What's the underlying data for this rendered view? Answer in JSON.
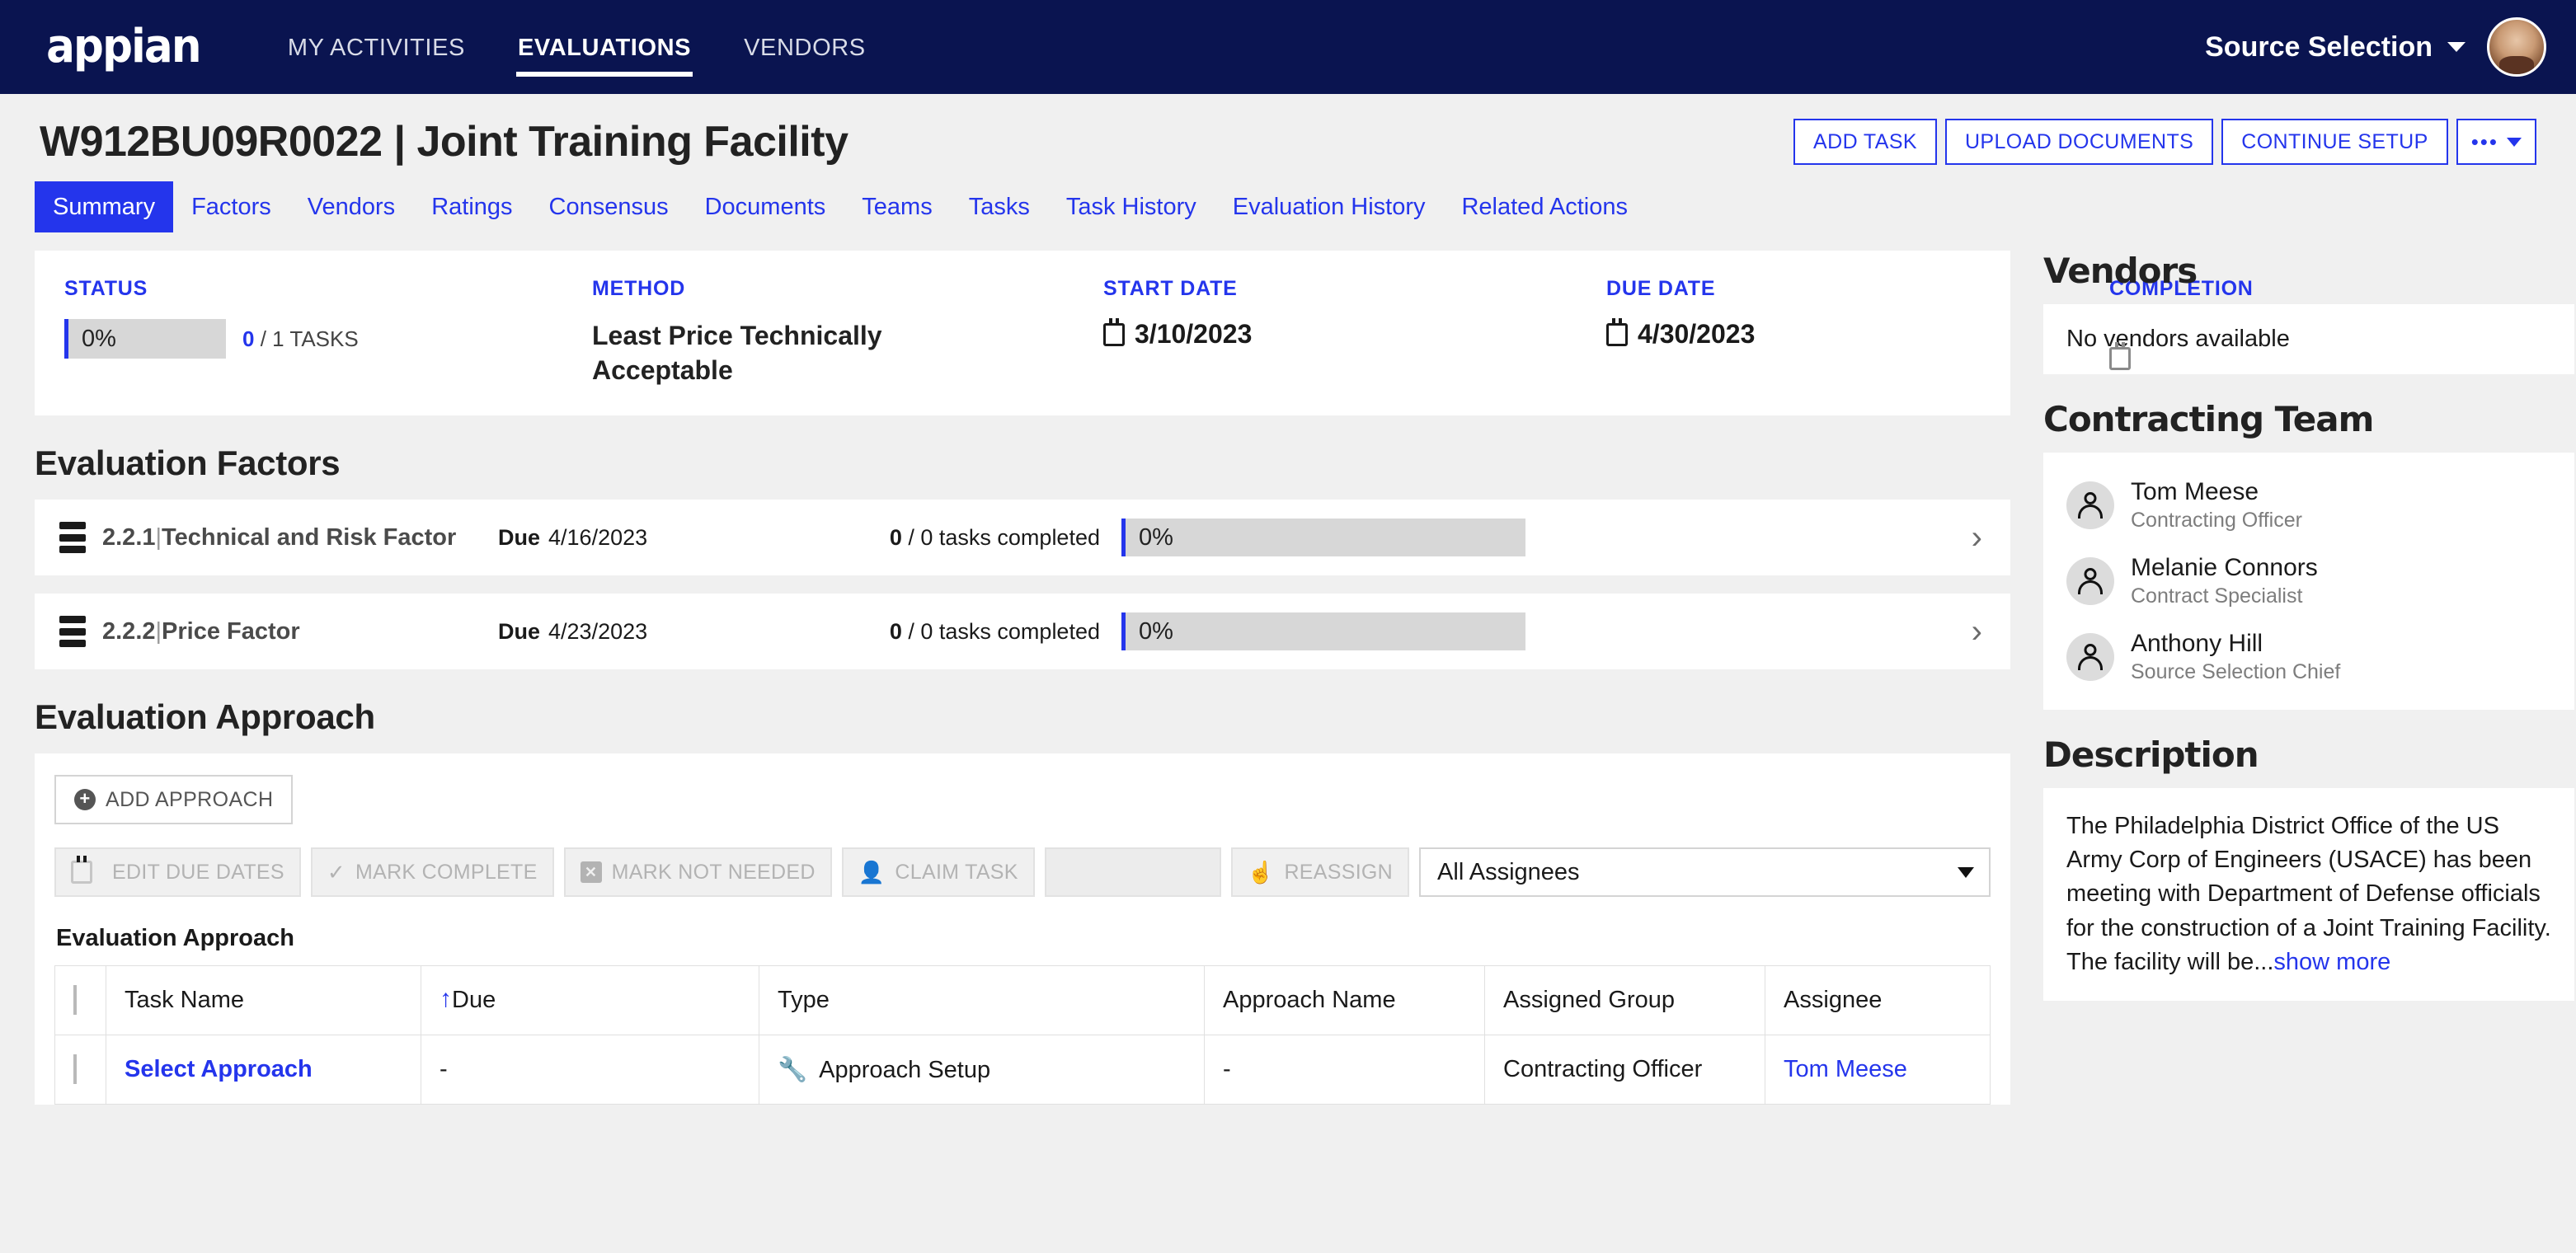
{
  "topnav": {
    "logo": "appian",
    "items": [
      {
        "label": "MY ACTIVITIES",
        "active": false
      },
      {
        "label": "EVALUATIONS",
        "active": true
      },
      {
        "label": "VENDORS",
        "active": false
      }
    ],
    "user": "Source Selection",
    "accent": "#0a1450"
  },
  "header": {
    "title": "W912BU09R0022 | Joint Training Facility",
    "actions": {
      "add_task": "ADD TASK",
      "upload_documents": "UPLOAD DOCUMENTS",
      "continue_setup": "CONTINUE SETUP",
      "more": "•••"
    }
  },
  "tabs": [
    {
      "label": "Summary",
      "active": true
    },
    {
      "label": "Factors",
      "active": false
    },
    {
      "label": "Vendors",
      "active": false
    },
    {
      "label": "Ratings",
      "active": false
    },
    {
      "label": "Consensus",
      "active": false
    },
    {
      "label": "Documents",
      "active": false
    },
    {
      "label": "Teams",
      "active": false
    },
    {
      "label": "Tasks",
      "active": false
    },
    {
      "label": "Task History",
      "active": false
    },
    {
      "label": "Evaluation History",
      "active": false
    },
    {
      "label": "Related Actions",
      "active": false
    }
  ],
  "status_card": {
    "status_label": "STATUS",
    "status_percent": "0%",
    "tasks_done": "0",
    "tasks_total_text": "/ 1 TASKS",
    "method_label": "METHOD",
    "method_value": "Least Price Technically Acceptable",
    "start_label": "START DATE",
    "start_value": "3/10/2023",
    "due_label": "DUE DATE",
    "due_value": "4/30/2023",
    "completion_label": "COMPLETION DATE",
    "completion_value": "--/--/--"
  },
  "factors": {
    "heading": "Evaluation Factors",
    "rows": [
      {
        "name": "2.2.1",
        "sep": "|",
        "title": "Technical and Risk Factor",
        "due_label": "Due",
        "due_value": "4/16/2023",
        "tasks_done": "0",
        "tasks_text": "/ 0 tasks completed",
        "percent": "0%"
      },
      {
        "name": "2.2.2",
        "sep": "|",
        "title": "Price Factor",
        "due_label": "Due",
        "due_value": "4/23/2023",
        "tasks_done": "0",
        "tasks_text": "/ 0 tasks completed",
        "percent": "0%"
      }
    ]
  },
  "approach": {
    "heading": "Evaluation Approach",
    "add_button": "ADD APPROACH",
    "toolbar": {
      "edit_due_dates": "EDIT DUE DATES",
      "mark_complete": "MARK COMPLETE",
      "mark_not_needed": "MARK NOT NEEDED",
      "claim_task": "CLAIM TASK",
      "reassign": "REASSIGN",
      "assignee_filter": "All Assignees"
    },
    "grid_title": "Evaluation Approach",
    "columns": [
      "Task Name",
      "Due",
      "Type",
      "Approach Name",
      "Assigned Group",
      "Assignee"
    ],
    "rows": [
      {
        "task_name": "Select Approach",
        "due": "-",
        "type": "Approach Setup",
        "approach_name": "-",
        "assigned_group": "Contracting Officer",
        "assignee": "Tom Meese"
      }
    ]
  },
  "sidebar": {
    "vendors_heading": "Vendors",
    "vendors_empty": "No vendors available",
    "team_heading": "Contracting Team",
    "team": [
      {
        "name": "Tom Meese",
        "role": "Contracting Officer"
      },
      {
        "name": "Melanie Connors",
        "role": "Contract Specialist"
      },
      {
        "name": "Anthony Hill",
        "role": "Source Selection Chief"
      }
    ],
    "description_heading": "Description",
    "description_text": "The Philadelphia District Office of the US Army Corp of Engineers (USACE) has been meeting with Department of Defense officials for the construction of a Joint Training Facility. The facility will be",
    "description_ellipsis": "...",
    "description_more": "show more"
  }
}
